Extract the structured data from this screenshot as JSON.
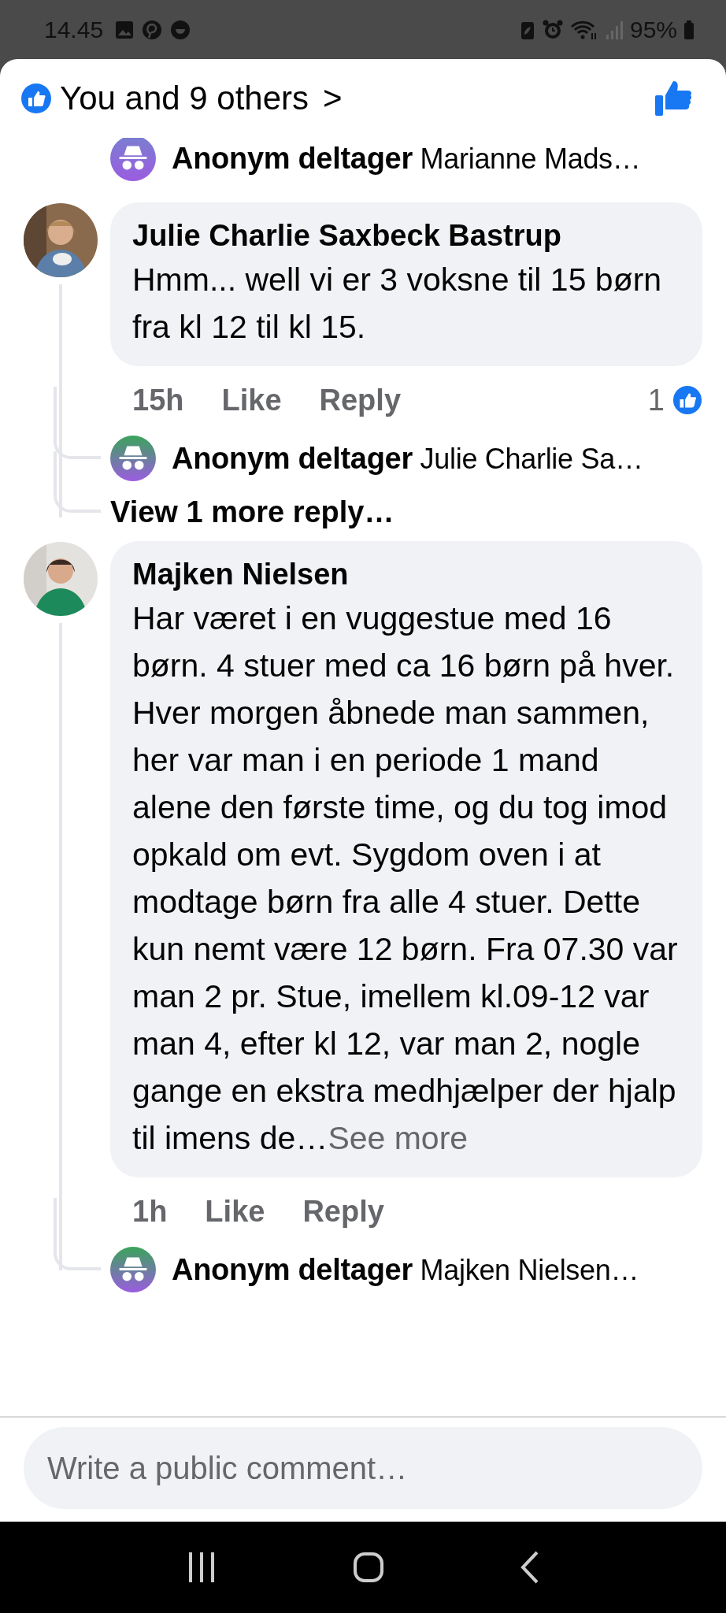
{
  "status_bar": {
    "time": "14.45",
    "battery": "95%"
  },
  "header": {
    "reactions": "You and 9 others",
    "chevron": ">"
  },
  "earlier_reply": {
    "author": "Anonym deltager",
    "text": "Marianne Mads…"
  },
  "comments": [
    {
      "author": "Julie Charlie Saxbeck Bastrup",
      "text": "Hmm... well vi er 3 voksne til 15 børn fra kl 12 til kl 15.",
      "time": "15h",
      "like": "Like",
      "reply": "Reply",
      "reaction_count": "1",
      "replies": [
        {
          "author": "Anonym deltager",
          "text": "Julie Charlie Sa…"
        }
      ],
      "more_replies": "View 1 more reply…"
    },
    {
      "author": "Majken Nielsen",
      "text": "Har været i en vuggestue med 16 børn. 4 stuer med ca 16 børn på hver. Hver morgen åbnede man sammen, her var man i en periode 1 mand alene den første time, og du tog imod opkald om evt. Sygdom oven i at modtage børn fra alle 4 stuer. Dette kun nemt være 12 børn. Fra 07.30 var man 2 pr. Stue, imellem kl.09-12 var man 4, efter kl 12, var man 2, nogle gange en ekstra medhjælper der hjalp til imens de…",
      "see_more": "See more",
      "time": "1h",
      "like": "Like",
      "reply": "Reply",
      "replies": [
        {
          "author": "Anonym deltager",
          "text": "Majken Nielsen…"
        }
      ]
    }
  ],
  "composer": {
    "placeholder": "Write a public comment…"
  }
}
